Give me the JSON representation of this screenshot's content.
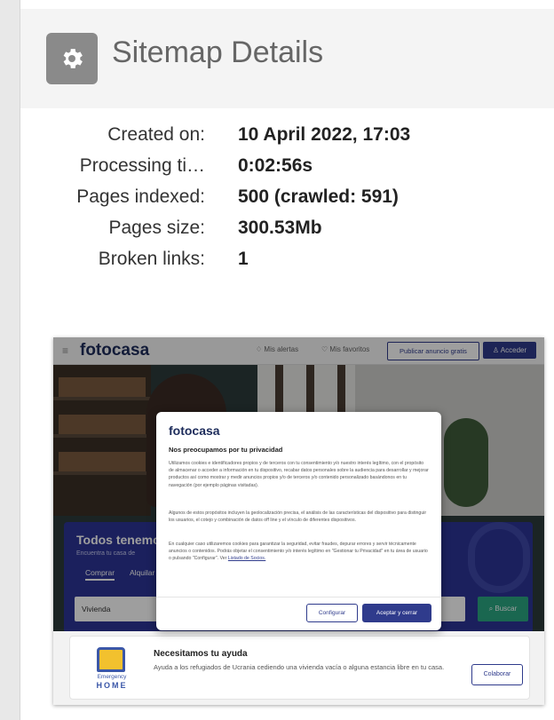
{
  "header": {
    "icon": "gear-icon",
    "title": "Sitemap Details"
  },
  "details": [
    {
      "label": "Created on:",
      "value": "10 April 2022, 17:03"
    },
    {
      "label": "Processing ti…",
      "value": "0:02:56s"
    },
    {
      "label": "Pages indexed:",
      "value": "500 (crawled: 591)"
    },
    {
      "label": "Pages size:",
      "value": "300.53Mb"
    },
    {
      "label": "Broken links:",
      "value": "1"
    }
  ],
  "screenshot": {
    "topbar": {
      "logo": "fotocasa",
      "alerts": "Mis alertas",
      "favorites": "Mis favoritos",
      "publish_button": "Publicar anuncio gratis",
      "login_button": "Acceder"
    },
    "search": {
      "title": "Todos tenemos",
      "subtitle": "Encuentra tu casa de",
      "tabs": [
        "Comprar",
        "Alquilar"
      ],
      "input_value": "Vivienda",
      "button": "Buscar"
    },
    "modal": {
      "logo": "fotocasa",
      "title": "Nos preocupamos por tu privacidad",
      "paragraph1": "Utilizamos cookies e identificadores propios y de terceros con tu consentimiento y/o nuestro interés legítimo, con el propósito de almacenar o acceder a información en tu dispositivo, recabar datos personales sobre la audiencia para desarrollar y mejorar productos así como mostrar y medir anuncios propios y/o de terceros y/o contenido personalizado basándonos en tu navegación (por ejemplo páginas visitadas).",
      "paragraph2": "Algunos de estos propósitos incluyen la geolocalización precisa, el análisis de las características del dispositivo para distinguir los usuarios, el cotejo y combinación de datos off line y el vínculo de diferentes dispositivos.",
      "paragraph3": "En cualquier caso utilizaremos cookies para garantizar la seguridad, evitar fraudes, depurar errores y servir técnicamente anuncios o contenidos. Podrás objetar el consentimiento y/o interés legítimo en \"Gestionar tu Privacidad\" en tu área de usuario o pulsando \"Configurar\". Ver",
      "link": "Listado de Socios.",
      "configure_button": "Configurar",
      "accept_button": "Aceptar y cerrar"
    },
    "card": {
      "logo_top": "Emergency",
      "logo_bottom": "HOME",
      "title": "Necesitamos tu ayuda",
      "text": "Ayuda a los refugiados de Ucrania cediendo una vivienda vacía o alguna estancia libre en tu casa.",
      "button": "Colaborar"
    }
  }
}
